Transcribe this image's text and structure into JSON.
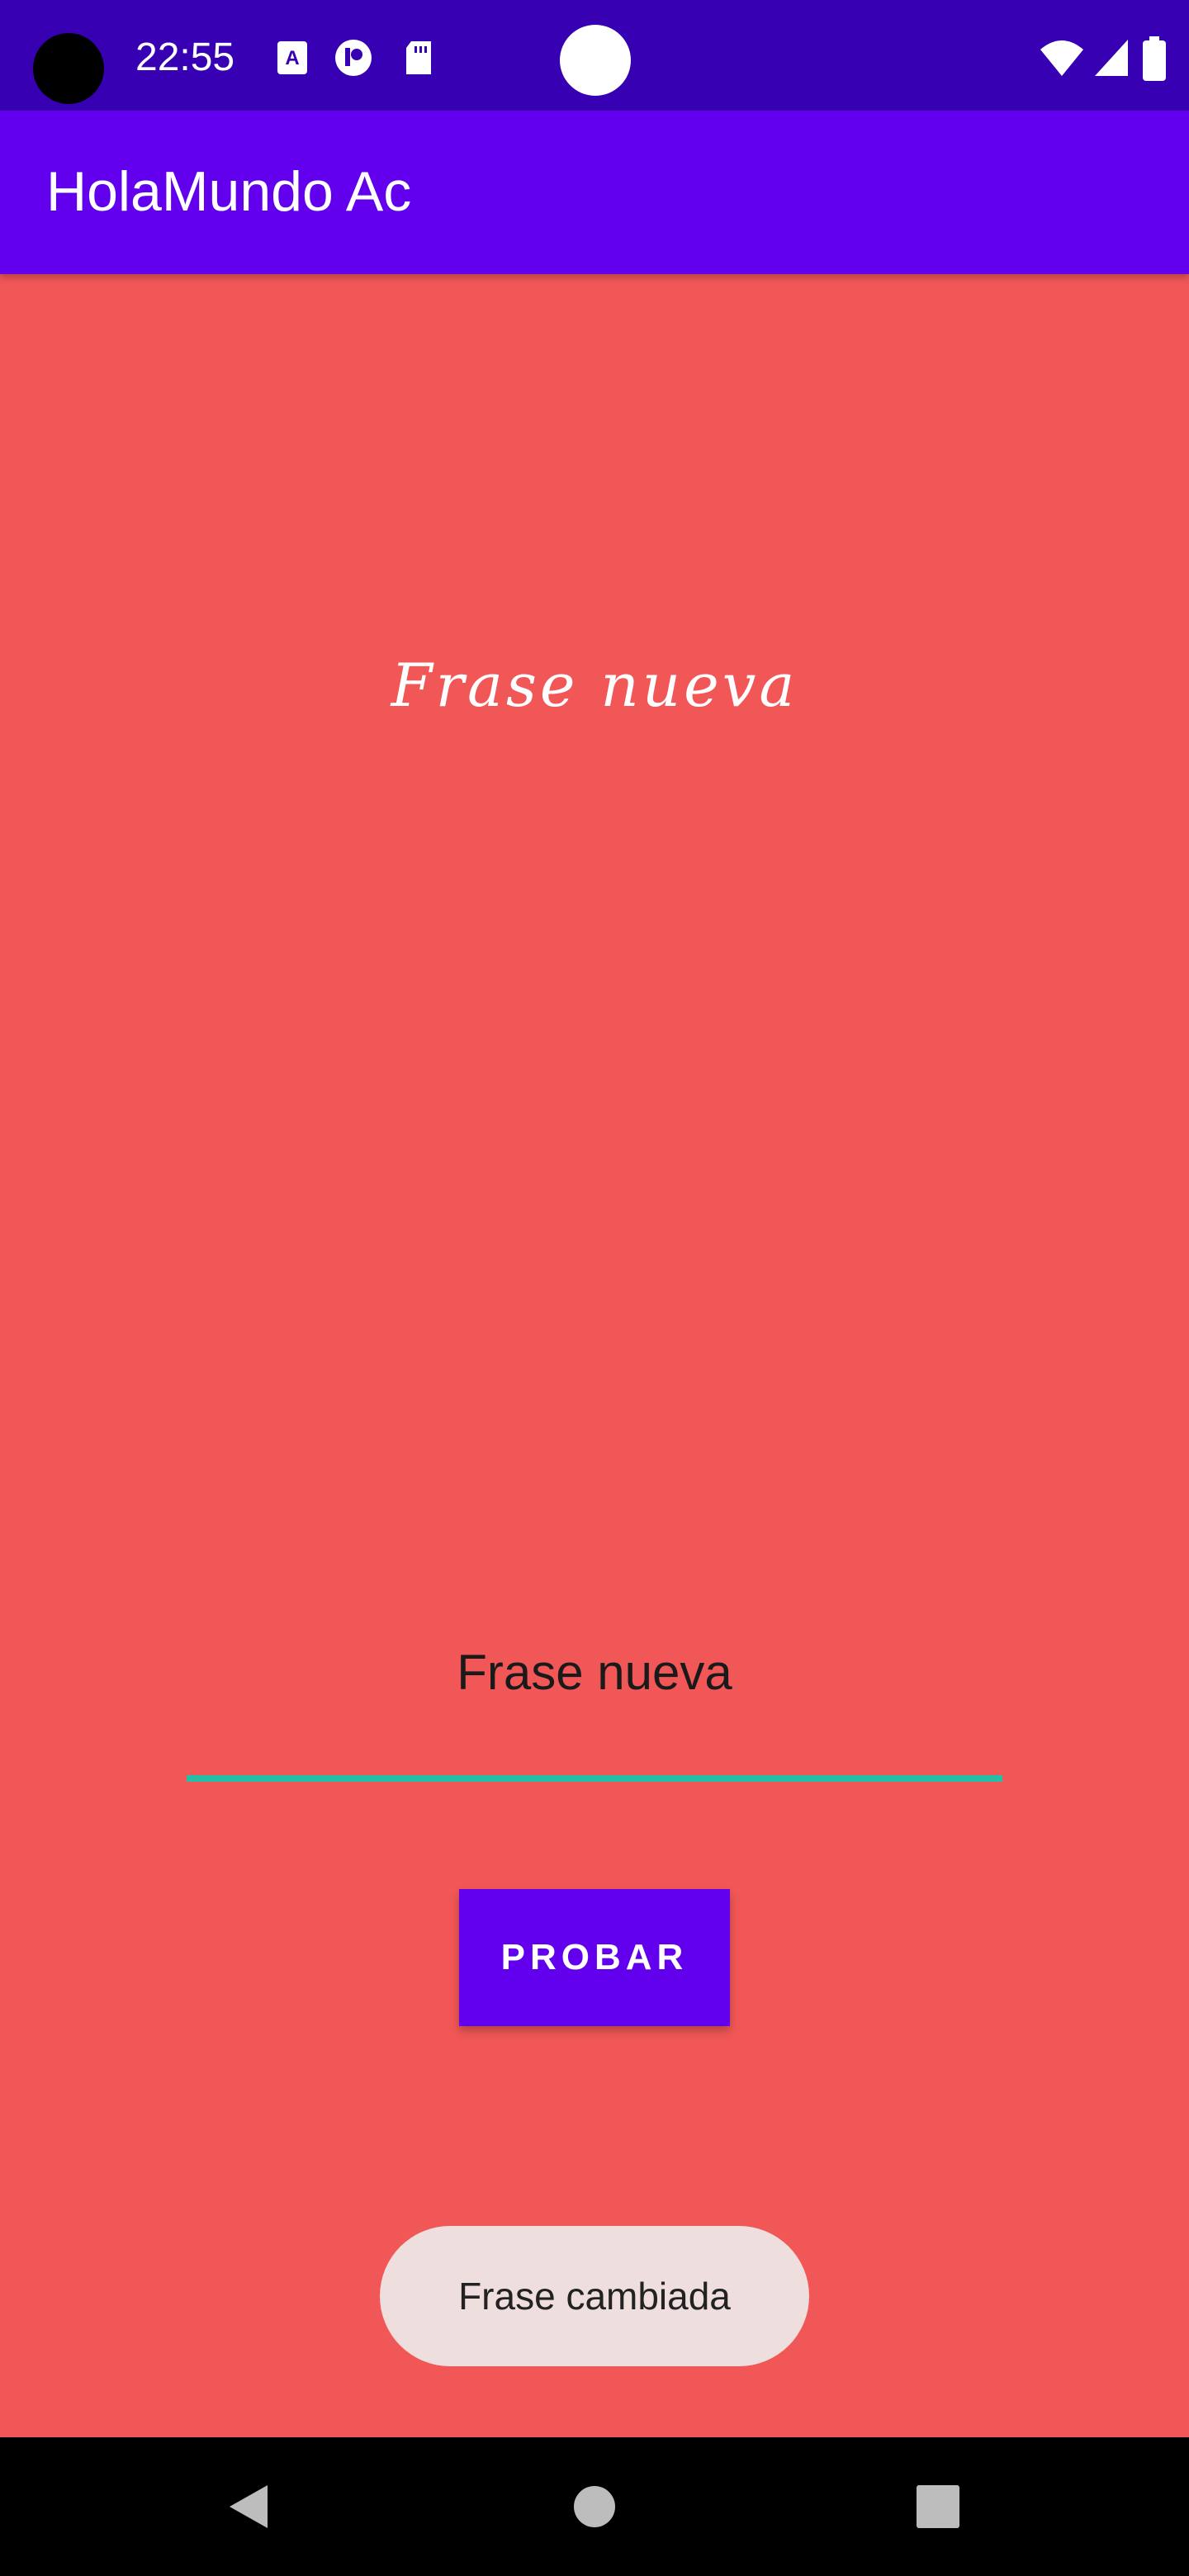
{
  "status_bar": {
    "time": "22:55",
    "icons": [
      "keyboard-a-icon",
      "app-notification-icon",
      "sd-card-icon",
      "wifi-icon",
      "signal-icon",
      "battery-icon"
    ]
  },
  "app_bar": {
    "title": "HolaMundo Ac"
  },
  "main": {
    "phrase_display": "Frase nueva",
    "phrase_input": {
      "value": "Frase nueva"
    },
    "button_label": "PROBAR"
  },
  "toast": {
    "message": "Frase cambiada"
  },
  "nav_bar": {
    "icons": [
      "back-icon",
      "home-icon",
      "recents-icon"
    ]
  },
  "colors": {
    "status_bar": "#3700b3",
    "app_bar": "#6200ee",
    "background": "#f25757",
    "button": "#6200ee",
    "input_underline": "#26bfa6",
    "toast": "#eedede"
  }
}
